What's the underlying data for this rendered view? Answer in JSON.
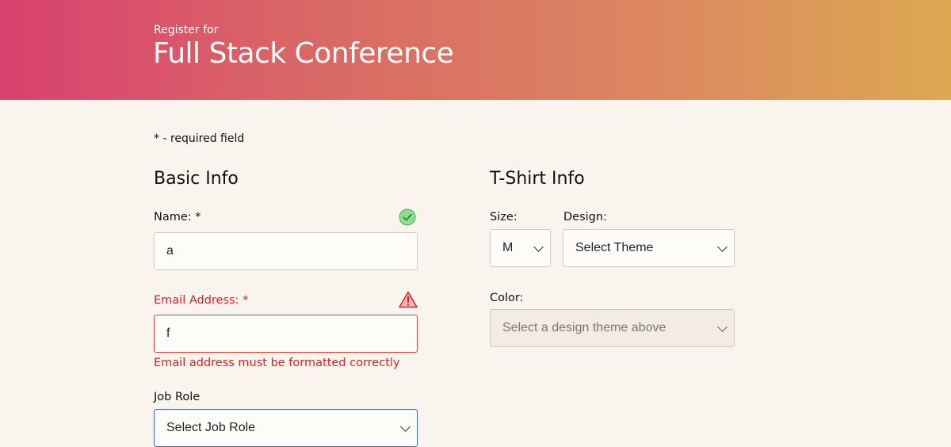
{
  "header": {
    "subtitle": "Register for",
    "title": "Full Stack Conference",
    "gradient_start": "#d8416f",
    "gradient_end": "#dca851"
  },
  "required_note": "* - required field",
  "basic_info": {
    "heading": "Basic Info",
    "name": {
      "label": "Name: *",
      "value": "a",
      "status_icon": "check-circle-icon"
    },
    "email": {
      "label": "Email Address: *",
      "value": "f",
      "status_icon": "warning-triangle-icon",
      "error_message": "Email address must be formatted correctly",
      "error_color": "#d81f26"
    },
    "job_role": {
      "label": "Job Role",
      "selected": "Select Job Role"
    }
  },
  "tshirt_info": {
    "heading": "T-Shirt Info",
    "size": {
      "label": "Size:",
      "selected": "M"
    },
    "design": {
      "label": "Design:",
      "selected": "Select Theme"
    },
    "color": {
      "label": "Color:",
      "selected": "Select a design theme above"
    }
  }
}
